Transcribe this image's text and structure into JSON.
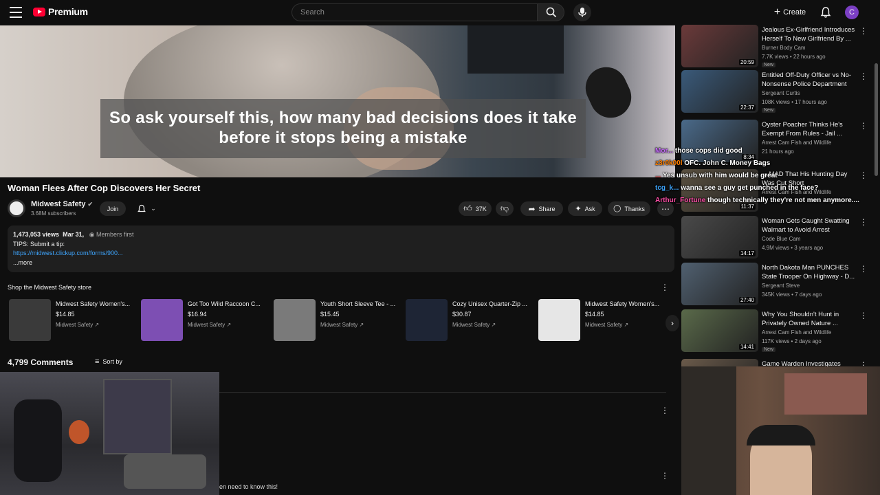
{
  "header": {
    "logo_text": "Premium",
    "search_placeholder": "Search",
    "create_label": "Create",
    "avatar_letter": "C"
  },
  "video": {
    "caption": "So ask yourself this, how many bad decisions does it take before it stops being a mistake",
    "title": "Woman Flees After Cop Discovers Her Secret"
  },
  "channel": {
    "name": "Midwest Safety",
    "subscribers": "3.68M subscribers",
    "join_label": "Join"
  },
  "actions": {
    "likes": "37K",
    "share": "Share",
    "ask": "Ask",
    "thanks": "Thanks"
  },
  "description": {
    "views": "1,473,053 views",
    "date": "Mar 31,",
    "members": "Members first",
    "line1": "TIPS: Submit a tip:",
    "link": "https://midwest.clickup.com/forms/900...",
    "more": "...more"
  },
  "store": {
    "label": "Shop the Midwest Safety store",
    "products": [
      {
        "name": "Midwest Safety Women's...",
        "price": "$14.85",
        "seller": "Midwest Safety",
        "color": "#3a3a3a"
      },
      {
        "name": "Got Too Wild Raccoon C...",
        "price": "$16.94",
        "seller": "Midwest Safety",
        "color": "#7d4fb3"
      },
      {
        "name": "Youth Short Sleeve Tee - ...",
        "price": "$15.45",
        "seller": "Midwest Safety",
        "color": "#7a7a7a"
      },
      {
        "name": "Cozy Unisex Quarter-Zip ...",
        "price": "$30.87",
        "seller": "Midwest Safety",
        "color": "#1e2535"
      },
      {
        "name": "Midwest Safety Women's...",
        "price": "$14.85",
        "seller": "Midwest Safety",
        "color": "#e6e6e6"
      }
    ]
  },
  "comments": {
    "count": "4,799 Comments",
    "sort": "Sort by",
    "tail_text": "en need to know this!"
  },
  "recommendations": [
    {
      "title": "Jealous Ex-Girlfriend Introduces Herself To New Girlfriend By ...",
      "channel": "Burner Body Cam",
      "meta": "7.7K views • 22 hours ago",
      "duration": "20:59",
      "new": "New",
      "thumb": "#6b3a3a"
    },
    {
      "title": "Entitled Off-Duty Officer vs No-Nonsense Police Department",
      "channel": "Sergeant Curtis",
      "meta": "108K views • 17 hours ago",
      "duration": "22:37",
      "new": "New",
      "thumb": "#3a5a7a"
    },
    {
      "title": "Oyster Poacher Thinks He's Exempt From Rules - Jail ...",
      "channel": "Arrest Cam Fish and Wildlife",
      "meta": "21 hours ago",
      "duration": "8:34",
      "new": "",
      "thumb": "#4a6a8a"
    },
    {
      "title": "... MAD That His Hunting Day Was Cut Short",
      "channel": "Arrest Cam Fish and Wildlife",
      "meta": "",
      "duration": "11:37",
      "new": "",
      "thumb": "#5a5040"
    },
    {
      "title": "Woman Gets Caught Swatting Walmart to Avoid Arrest",
      "channel": "Code Blue Cam",
      "meta": "4.9M views • 3 years ago",
      "duration": "14:17",
      "new": "",
      "thumb": "#4a4a4a"
    },
    {
      "title": "North Dakota Man PUNCHES State Trooper On Highway - D...",
      "channel": "Sergeant Steve",
      "meta": "345K views • 7 days ago",
      "duration": "27:40",
      "new": "",
      "thumb": "#506070"
    },
    {
      "title": "Why You Shouldn't Hunt in Privately Owned Nature ...",
      "channel": "Arrest Cam Fish and Wildlife",
      "meta": "117K views • 2 days ago",
      "duration": "14:41",
      "new": "New",
      "thumb": "#5a6a4a"
    },
    {
      "title": "Game Warden Investigates",
      "channel": "",
      "meta": "",
      "duration": "",
      "new": "",
      "thumb": "#6a5a4a"
    }
  ],
  "chat": [
    {
      "user": "Mor...",
      "msg": "those cops did good",
      "color": "#c86cff"
    },
    {
      "user": "z3r0k00l",
      "msg": "OFC. John C. Money Bags",
      "color": "#ff7f00"
    },
    {
      "user": "...",
      "msg": "Yes unsub with him would be great",
      "color": "#ff4040"
    },
    {
      "user": "tcg_k...",
      "msg": "wanna see a guy get punched in the face?",
      "color": "#3ea6ff"
    },
    {
      "user": "Arthur_Fortune",
      "msg": "though technically they're not men anymore....",
      "color": "#ff4fa8"
    }
  ]
}
